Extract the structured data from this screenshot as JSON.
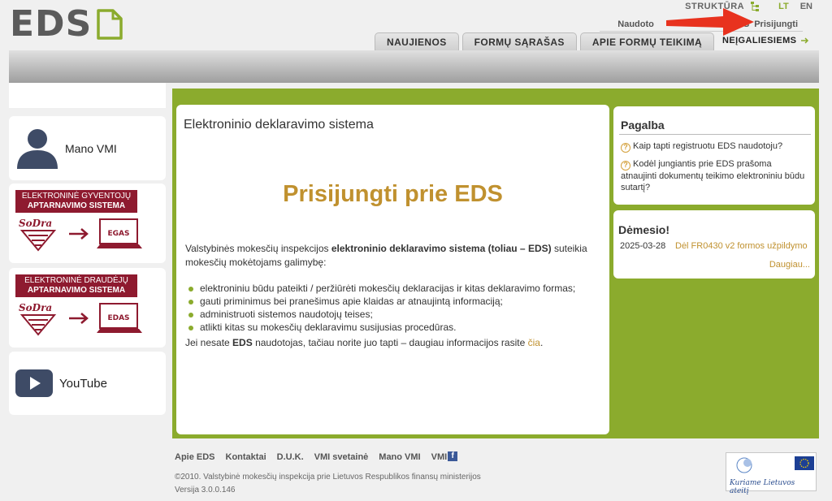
{
  "logo": {
    "text": "EDS"
  },
  "top": {
    "struktura": "STRUKTŪRA",
    "lang_lt": "LT",
    "lang_en": "EN"
  },
  "user_links": {
    "users": "Naudoto",
    "suffix": "S",
    "login": "Prisijungti"
  },
  "tabs": [
    {
      "label": "NAUJIENOS"
    },
    {
      "label": "FORMŲ SĄRAŠAS"
    },
    {
      "label": "APIE FORMŲ TEIKIMĄ"
    }
  ],
  "disabled_link": {
    "label": "NEĮGALIESIEMS"
  },
  "sidebar": {
    "mano_vmi": "Mano VMI",
    "banner1": {
      "line1": "ELEKTRONINĖ GYVENTOJŲ",
      "line2": "APTARNAVIMO SISTEMA",
      "brand": "SoDra",
      "system": "EGAS"
    },
    "banner2": {
      "line1": "ELEKTRONINĖ DRAUDĖJŲ",
      "line2": "APTARNAVIMO SISTEMA",
      "brand": "SoDra",
      "system": "EDAS"
    },
    "youtube": "YouTube"
  },
  "main": {
    "title": "Elektroninio deklaravimo sistema",
    "big_title": "Prisijungti prie EDS",
    "intro_a": "Valstybinės mokesčių inspekcijos ",
    "intro_b": "elektroninio deklaravimo sistema (toliau – EDS)",
    "intro_c": " suteikia mokesčių mokėtojams galimybę:",
    "bullets": [
      "elektroniniu būdu pateikti / peržiūrėti mokesčių deklaracijas ir kitas deklaravimo formas;",
      "gauti priminimus bei pranešimus apie klaidas ar atnaujintą informaciją;",
      "administruoti sistemos naudotojų teises;",
      "atlikti kitas su mokesčių deklaravimu susijusias procedūras."
    ],
    "foot_a": "Jei nesate ",
    "foot_b": "EDS",
    "foot_c": " naudotojas, tačiau norite juo tapti – daugiau informacijos rasite ",
    "foot_link": "čia",
    "foot_d": "."
  },
  "help": {
    "title": "Pagalba",
    "items": [
      "Kaip tapti registruotu EDS naudotoju?",
      "Kodėl jungiantis prie EDS prašoma atnaujinti dokumentų teikimo elektroniniu būdu sutartį?"
    ]
  },
  "attention": {
    "title": "Dėmesio!",
    "date": "2025-03-28",
    "link": "Dėl FR0430 v2 formos užpildymo",
    "more": "Daugiau..."
  },
  "footer": {
    "links": [
      "Apie EDS",
      "Kontaktai",
      "D.U.K.",
      "VMI svetainė",
      "Mano VMI",
      "VMI"
    ],
    "copyright": "©2010. Valstybinė mokesčių inspekcija prie Lietuvos Respublikos finansų ministerijos",
    "version": "Versija 3.0.0.146",
    "eu_motto": "Kuriame Lietuvos ateitį"
  },
  "colors": {
    "accent": "#8bab2d",
    "gold": "#c0912f",
    "sodra": "#8e1a2f",
    "arrow": "#e8321e"
  }
}
